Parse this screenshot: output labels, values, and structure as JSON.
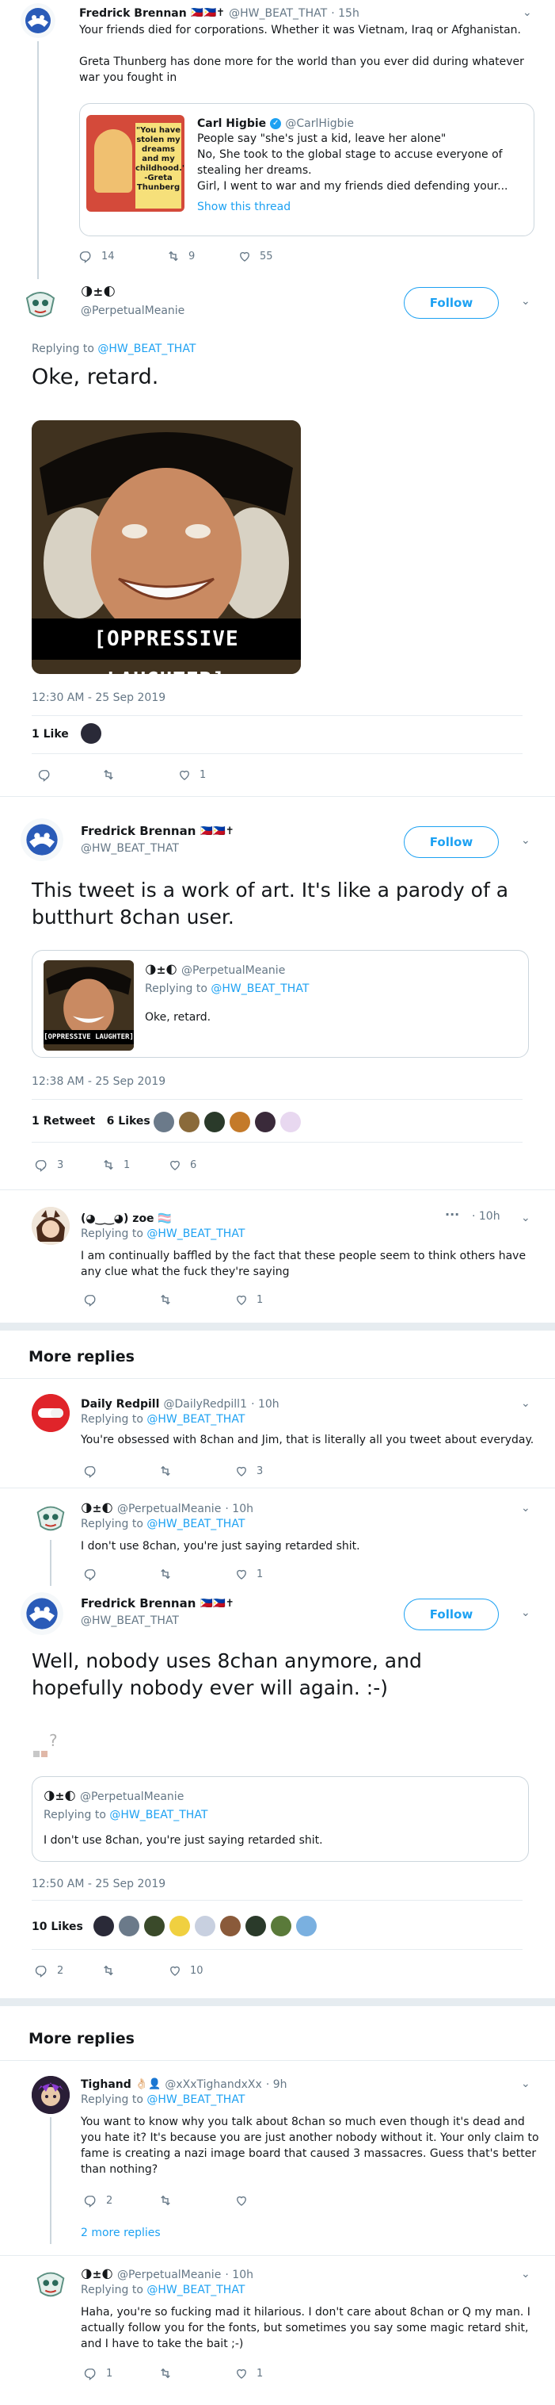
{
  "colors": {
    "accent": "#1da1f2",
    "muted": "#657786",
    "border": "#e6ecf0"
  },
  "icons": {
    "reply": "reply-icon",
    "retweet": "retweet-icon",
    "like": "like-icon",
    "chevron": "chevron-down-icon",
    "verified": "verified-icon"
  },
  "top_tweet": {
    "name": "Fredrick Brennan",
    "flags": "🇵🇭🇵🇭✝",
    "handle": "@HW_BEAT_THAT",
    "time": "· 15h",
    "text1": "Your friends died for corporations. Whether it was Vietnam, Iraq or Afghanistan.",
    "text2": "Greta Thunberg has done more for the world than you ever did during whatever war you fought in",
    "quote": {
      "name": "Carl Higbie",
      "handle": "@CarlHigbie",
      "line1": "People say \"she's just a kid, leave her alone\"",
      "line2": "No, She took to the global stage to accuse everyone of stealing her dreams.",
      "line3": "Girl, I went to war and my friends died defending your...",
      "show_thread": "Show this thread",
      "thumb_text": "\"You have stolen my dreams and my childhood.\" -Greta Thunberg"
    },
    "reply_count": "14",
    "retweet_count": "9",
    "like_count": "55"
  },
  "pm_tweet": {
    "name": "🌗±🌓",
    "handle": "@PerpetualMeanie",
    "follow": "Follow",
    "replying_prefix": "Replying to",
    "replying_handle": "@HW_BEAT_THAT",
    "text": "Oke, retard.",
    "image_caption": "[OPPRESSIVE LAUGHTER]",
    "timestamp": "12:30 AM - 25 Sep 2019",
    "likes_label": "1 Like",
    "like_count": "1"
  },
  "fb_main": {
    "name": "Fredrick Brennan",
    "flags": "🇵🇭🇵🇭✝",
    "handle": "@HW_BEAT_THAT",
    "follow": "Follow",
    "text": "This tweet is a work of art. It's like a parody of a butthurt 8chan user.",
    "quote": {
      "name": "🌗±🌓",
      "handle": "@PerpetualMeanie",
      "replying_prefix": "Replying to",
      "replying_handle": "@HW_BEAT_THAT",
      "text": "Oke, retard.",
      "thumb_caption": "[OPPRESSIVE LAUGHTER]"
    },
    "timestamp": "12:38 AM - 25 Sep 2019",
    "retweets_label": "1 Retweet",
    "likes_label": "6 Likes",
    "reply_count": "3",
    "retweet_count": "1",
    "like_count": "6"
  },
  "zoe_reply": {
    "name": "(◕‿‿◕) zoe 🏳️‍⚧️",
    "more": "···",
    "time": "· 10h",
    "replying_prefix": "Replying to",
    "replying_handle": "@HW_BEAT_THAT",
    "text": "I am continually baffled by the fact that these people seem to think others have any clue what the fuck they're saying",
    "like_count": "1"
  },
  "more_replies_1": "More replies",
  "redpill_reply": {
    "name": "Daily Redpill",
    "handle": "@DailyRedpill1",
    "time": "· 10h",
    "replying_prefix": "Replying to",
    "replying_handle": "@HW_BEAT_THAT",
    "text": "You're obsessed with 8chan and Jim, that is literally all you tweet about everyday.",
    "like_count": "3"
  },
  "pm_reply_2": {
    "name": "🌗±🌓",
    "handle": "@PerpetualMeanie",
    "time": "· 10h",
    "replying_prefix": "Replying to",
    "replying_handle": "@HW_BEAT_THAT",
    "text": "I don't use 8chan, you're just saying retarded shit.",
    "like_count": "1"
  },
  "fb_main_2": {
    "name": "Fredrick Brennan",
    "flags": "🇵🇭🇵🇭✝",
    "handle": "@HW_BEAT_THAT",
    "follow": "Follow",
    "text": "Well, nobody uses 8chan anymore, and hopefully nobody ever will again. :-)",
    "quote": {
      "name": "🌗±🌓",
      "handle": "@PerpetualMeanie",
      "replying_prefix": "Replying to",
      "replying_handle": "@HW_BEAT_THAT",
      "text": "I don't use 8chan, you're just saying retarded shit."
    },
    "timestamp": "12:50 AM - 25 Sep 2019",
    "likes_label": "10 Likes",
    "reply_count": "2",
    "like_count": "10"
  },
  "more_replies_2": "More replies",
  "tighand_reply": {
    "name": "Tighand",
    "badges": "👌🏻👤",
    "handle": "@xXxTighandxXx",
    "time": "· 9h",
    "replying_prefix": "Replying to",
    "replying_handle": "@HW_BEAT_THAT",
    "text": "You want to know why you talk about 8chan so much even though it's dead and you hate it? It's because you are just another nobody without it. Your only claim to fame is creating a nazi image board that caused 3 massacres. Guess that's better than nothing?",
    "reply_count": "2",
    "more_replies_link": "2 more replies"
  },
  "pm_reply_3": {
    "name": "🌗±🌓",
    "handle": "@PerpetualMeanie",
    "time": "· 10h",
    "replying_prefix": "Replying to",
    "replying_handle": "@HW_BEAT_THAT",
    "text": "Haha, you're so fucking mad it hilarious. I don't care about 8chan or Q my man. I actually follow you for the fonts, but sometimes you say some magic retard shit, and I have to take the bait ;-)",
    "reply_count": "1",
    "like_count": "1"
  }
}
